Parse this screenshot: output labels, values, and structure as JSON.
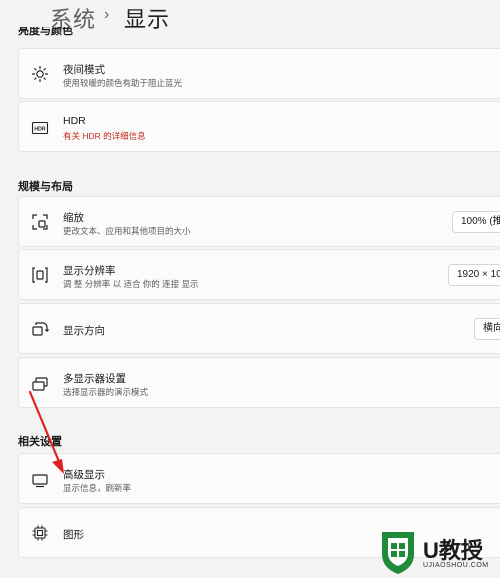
{
  "breadcrumb": {
    "parent": "系统",
    "separator": "›",
    "current": "显示"
  },
  "sections": {
    "brightness_color": "亮度与颜色",
    "scale_layout": "规模与布局",
    "related": "相关设置"
  },
  "night_light": {
    "title": "夜间模式",
    "subtitle": "使用较暖的颜色有助于阻止蓝光"
  },
  "hdr": {
    "title": "HDR",
    "link": "有关 HDR 的详细信息"
  },
  "scale": {
    "title": "缩放",
    "subtitle": "更改文本、应用和其他项目的大小",
    "value": "100% (推"
  },
  "resolution": {
    "title": "显示分辨率",
    "subtitle": "调 整 分辨率 以 适合 你的 连接 显示",
    "value": "1920 × 10"
  },
  "orientation": {
    "title": "显示方向",
    "value": "横向"
  },
  "multi_display": {
    "title": "多显示器设置",
    "subtitle": "选择显示器的演示模式"
  },
  "advanced_display": {
    "title": "高级显示",
    "subtitle": "显示信息，刷新率"
  },
  "graphics": {
    "title": "图形"
  },
  "watermark": {
    "brand": "U教授",
    "url": "UJIAOSHOU.COM"
  },
  "colors": {
    "annotation_arrow": "#e02020",
    "watermark_green": "#1f8a3a",
    "link_red": "#c42b1c"
  }
}
